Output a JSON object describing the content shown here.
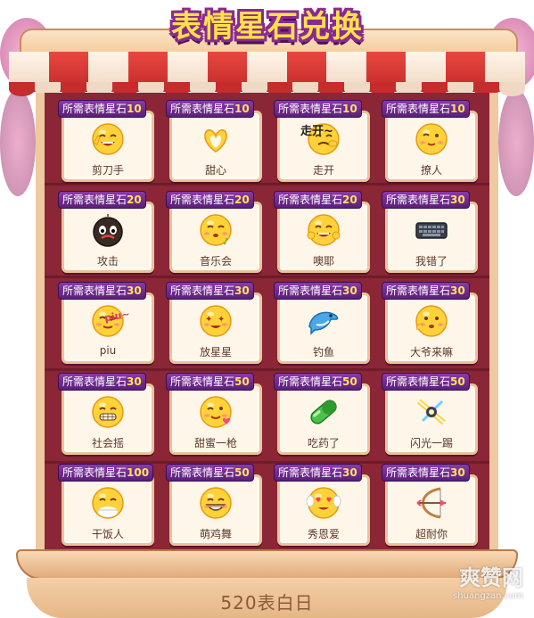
{
  "title": "表情星石兑换",
  "cost_prefix": "所需表情星石",
  "items": [
    {
      "name": "剪刀手",
      "cost": "10",
      "icon": "smiley-scissors-hand-icon",
      "overlay": ""
    },
    {
      "name": "甜心",
      "cost": "10",
      "icon": "heart-hands-icon",
      "overlay": ""
    },
    {
      "name": "走开",
      "cost": "10",
      "icon": "smiley-go-away-icon",
      "overlay": "走开~"
    },
    {
      "name": "撩人",
      "cost": "10",
      "icon": "smiley-flirt-icon",
      "overlay": ""
    },
    {
      "name": "攻击",
      "cost": "20",
      "icon": "black-bomb-face-icon",
      "overlay": ""
    },
    {
      "name": "音乐会",
      "cost": "20",
      "icon": "smiley-music-icon",
      "overlay": ""
    },
    {
      "name": "噢耶",
      "cost": "20",
      "icon": "smiley-cheer-icon",
      "overlay": ""
    },
    {
      "name": "我错了",
      "cost": "30",
      "icon": "keyboard-icon",
      "overlay": ""
    },
    {
      "name": "piu",
      "cost": "30",
      "icon": "smiley-piu-icon",
      "overlay": "piu~"
    },
    {
      "name": "放星星",
      "cost": "30",
      "icon": "smiley-star-eyes-icon",
      "overlay": ""
    },
    {
      "name": "钓鱼",
      "cost": "30",
      "icon": "dolphin-icon",
      "overlay": ""
    },
    {
      "name": "大爷来嘛",
      "cost": "30",
      "icon": "smiley-beckon-icon",
      "overlay": ""
    },
    {
      "name": "社会摇",
      "cost": "30",
      "icon": "smiley-grin-shake-icon",
      "overlay": ""
    },
    {
      "name": "甜蜜一枪",
      "cost": "50",
      "icon": "smiley-wink-heart-icon",
      "overlay": ""
    },
    {
      "name": "吃药了",
      "cost": "50",
      "icon": "green-pill-icon",
      "overlay": ""
    },
    {
      "name": "闪光一踢",
      "cost": "50",
      "icon": "flash-kick-icon",
      "overlay": ""
    },
    {
      "name": "干饭人",
      "cost": "100",
      "icon": "smiley-rice-bowl-icon",
      "overlay": ""
    },
    {
      "name": "萌鸡舞",
      "cost": "50",
      "icon": "smiley-big-grin-icon",
      "overlay": ""
    },
    {
      "name": "秀恩爱",
      "cost": "30",
      "icon": "smiley-angel-love-icon",
      "overlay": ""
    },
    {
      "name": "超耐你",
      "cost": "30",
      "icon": "bow-arrow-icon",
      "overlay": ""
    }
  ],
  "footer_text": "520表白日",
  "watermark": {
    "main": "爽赞网",
    "sub": "shuangzan.com"
  },
  "colors": {
    "board": "#8d2a38",
    "frame": "#efc9a0",
    "tag": "#6b2a8e",
    "tag_number": "#ffe35a",
    "title": "#ffe14a",
    "awning_red": "#d63a36"
  }
}
